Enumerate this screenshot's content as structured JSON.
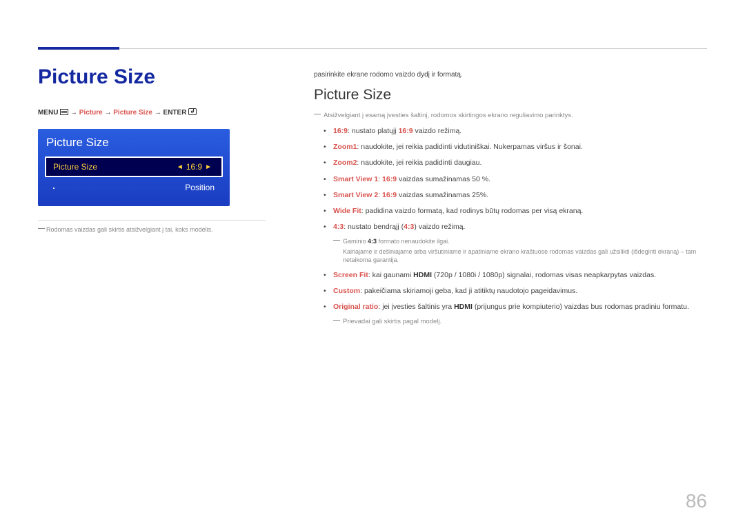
{
  "page_number": "86",
  "left": {
    "title": "Picture Size",
    "breadcrumb": {
      "menu": "MENU",
      "arrow": " → ",
      "p1": "Picture",
      "p2": "Picture Size",
      "enter": "ENTER"
    },
    "osd": {
      "title": "Picture Size",
      "row_selected": {
        "label": "Picture Size",
        "value": "16:9"
      },
      "row_sub": {
        "label": "Position"
      }
    },
    "note": "Rodomas vaizdas gali skirtis atsižvelgiant į tai, koks modelis."
  },
  "right": {
    "intro": "pasirinkite ekrane rodomo vaizdo dydį ir formatą.",
    "h2": "Picture Size",
    "note1": "Atsižvelgiant į esamą įvesties šaltinį, rodomos skirtingos ekrano reguliavimo parinktys.",
    "items": [
      {
        "lead": "16:9",
        "sep": ": ",
        "body": "nustato platųjį ",
        "mid": "16:9",
        "tail": " vaizdo režimą."
      },
      {
        "lead": "Zoom1",
        "sep": ": ",
        "body": "naudokite, jei reikia padidinti vidutiniškai. Nukerpamas viršus ir šonai."
      },
      {
        "lead": "Zoom2",
        "sep": ": ",
        "body": "naudokite, jei reikia padidinti daugiau."
      },
      {
        "lead": "Smart View 1",
        "sep": ": ",
        "mid": "16:9",
        "body": " vaizdas sumažinamas 50 %."
      },
      {
        "lead": "Smart View 2",
        "sep": ": ",
        "mid": "16:9",
        "body": " vaizdas sumažinamas 25%."
      },
      {
        "lead": "Wide Fit",
        "sep": ": ",
        "body": "padidina vaizdo formatą, kad rodinys būtų rodomas per visą ekraną."
      },
      {
        "lead": "4:3",
        "sep": ": ",
        "body": "nustato bendrąjį (",
        "mid": "4:3",
        "tail": ") vaizdo režimą.",
        "sub_notes": [
          "Gaminio 4:3 formato nenaudokite ilgai.",
          "Kairiajame ir dešiniajame arba viršutiniame ir apatiniame ekrano kraštuose rodomas vaizdas gali užsilikti (išdeginti ekraną) – tam netaikoma garantija."
        ],
        "sub_bold": "4:3"
      },
      {
        "lead": "Screen Fit",
        "sep": ": ",
        "body": "kai gaunami ",
        "mid_b": "HDMI",
        "body2": " (720p / 1080i / 1080p) signalai, rodomas visas neapkarpytas vaizdas."
      },
      {
        "lead": "Custom",
        "sep": ": ",
        "body": "pakeičiama skiriamoji geba, kad ji atitiktų naudotojo pageidavimus."
      },
      {
        "lead": "Original ratio",
        "sep": ": ",
        "body": "jei įvesties šaltinis yra ",
        "mid_b": "HDMI",
        "body2": " (prijungus prie kompiuterio) vaizdas bus rodomas pradiniu formatu."
      }
    ],
    "note2": "Prievadai gali skirtis pagal modelį."
  }
}
